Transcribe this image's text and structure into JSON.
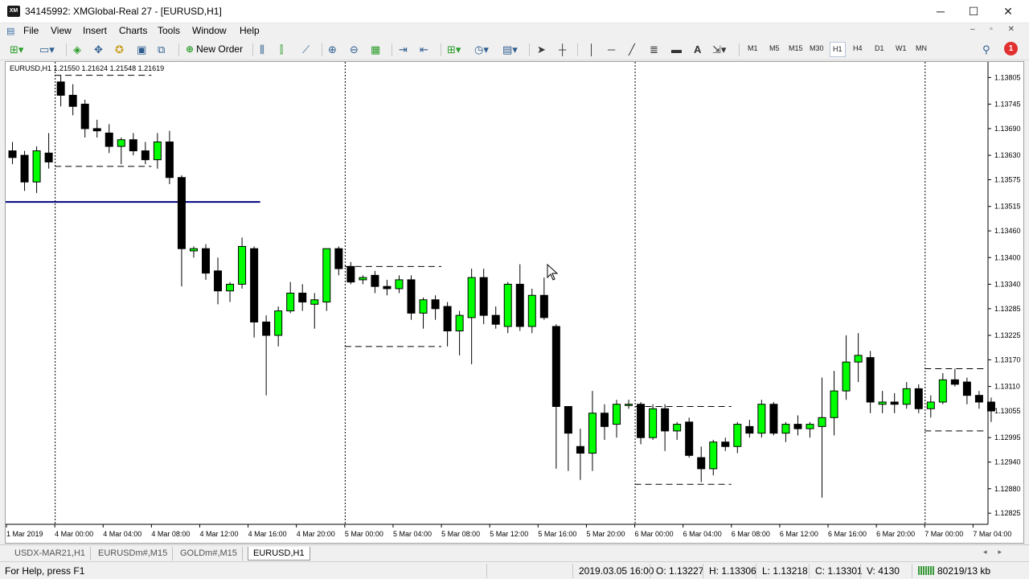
{
  "window": {
    "title": "34145992: XMGlobal-Real 27 - [EURUSD,H1]",
    "app_icon_text": "XM"
  },
  "menu": [
    "File",
    "View",
    "Insert",
    "Charts",
    "Tools",
    "Window",
    "Help"
  ],
  "toolbar": {
    "new_order_label": "New Order",
    "timeframes": [
      "M1",
      "M5",
      "M15",
      "M30",
      "H1",
      "H4",
      "D1",
      "W1",
      "MN"
    ],
    "active_timeframe": "H1",
    "alert_count": "1"
  },
  "chart": {
    "symbol_info": "EURUSD,H1  1.21550 1.21624 1.21548 1.21619",
    "colors": {
      "bull": "#00ff00",
      "bear": "#000000",
      "line": "#00007f",
      "grid": "#000000"
    }
  },
  "chart_data": {
    "type": "candlestick",
    "symbol": "EURUSD",
    "timeframe": "H1",
    "ylim": [
      1.128,
      1.1384
    ],
    "y_ticks": [
      "1.13805",
      "1.13745",
      "1.13690",
      "1.13630",
      "1.13575",
      "1.13515",
      "1.13460",
      "1.13400",
      "1.13340",
      "1.13285",
      "1.13225",
      "1.13170",
      "1.13110",
      "1.13055",
      "1.12995",
      "1.12940",
      "1.12880",
      "1.12825"
    ],
    "x_ticks": [
      "1 Mar 2019",
      "4 Mar 00:00",
      "4 Mar 04:00",
      "4 Mar 08:00",
      "4 Mar 12:00",
      "4 Mar 16:00",
      "4 Mar 20:00",
      "5 Mar 00:00",
      "5 Mar 04:00",
      "5 Mar 08:00",
      "5 Mar 12:00",
      "5 Mar 16:00",
      "5 Mar 20:00",
      "6 Mar 00:00",
      "6 Mar 04:00",
      "6 Mar 08:00",
      "6 Mar 12:00",
      "6 Mar 16:00",
      "6 Mar 20:00",
      "7 Mar 00:00",
      "7 Mar 04:00"
    ],
    "period_separators": [
      "4 Mar 00:00",
      "5 Mar 00:00",
      "6 Mar 00:00",
      "7 Mar 00:00"
    ],
    "horizontal_line": {
      "price": 1.13525,
      "from_bar": 0,
      "to_bar": 20
    },
    "range_boxes": [
      {
        "from_bar": 4,
        "to_bar": 12,
        "high": 1.1381,
        "low": 1.13605
      },
      {
        "from_bar": 28,
        "to_bar": 36,
        "high": 1.1338,
        "low": 1.132
      },
      {
        "from_bar": 52,
        "to_bar": 60,
        "high": 1.13065,
        "low": 1.1289
      },
      {
        "from_bar": 76,
        "to_bar": 81,
        "high": 1.1315,
        "low": 1.1301
      }
    ],
    "candles": [
      {
        "o": 1.1364,
        "h": 1.1366,
        "l": 1.1361,
        "c": 1.13625
      },
      {
        "o": 1.1363,
        "h": 1.1364,
        "l": 1.1355,
        "c": 1.1357
      },
      {
        "o": 1.1357,
        "h": 1.1365,
        "l": 1.13545,
        "c": 1.1364
      },
      {
        "o": 1.13635,
        "h": 1.1368,
        "l": 1.136,
        "c": 1.13615
      },
      {
        "o": 1.13795,
        "h": 1.1381,
        "l": 1.1374,
        "c": 1.13765
      },
      {
        "o": 1.13765,
        "h": 1.1379,
        "l": 1.1372,
        "c": 1.1374
      },
      {
        "o": 1.13745,
        "h": 1.13755,
        "l": 1.1367,
        "c": 1.1369
      },
      {
        "o": 1.1369,
        "h": 1.1371,
        "l": 1.1367,
        "c": 1.13685
      },
      {
        "o": 1.1368,
        "h": 1.137,
        "l": 1.13635,
        "c": 1.1365
      },
      {
        "o": 1.1365,
        "h": 1.1367,
        "l": 1.1361,
        "c": 1.13665
      },
      {
        "o": 1.13665,
        "h": 1.1368,
        "l": 1.1363,
        "c": 1.1364
      },
      {
        "o": 1.1364,
        "h": 1.1366,
        "l": 1.1361,
        "c": 1.1362
      },
      {
        "o": 1.1362,
        "h": 1.1368,
        "l": 1.136,
        "c": 1.1366
      },
      {
        "o": 1.1366,
        "h": 1.13685,
        "l": 1.13565,
        "c": 1.1358
      },
      {
        "o": 1.1358,
        "h": 1.13585,
        "l": 1.13335,
        "c": 1.1342
      },
      {
        "o": 1.13415,
        "h": 1.13425,
        "l": 1.134,
        "c": 1.1342
      },
      {
        "o": 1.1342,
        "h": 1.1343,
        "l": 1.1335,
        "c": 1.13365
      },
      {
        "o": 1.1337,
        "h": 1.134,
        "l": 1.13295,
        "c": 1.13325
      },
      {
        "o": 1.13325,
        "h": 1.13345,
        "l": 1.133,
        "c": 1.1334
      },
      {
        "o": 1.1334,
        "h": 1.13445,
        "l": 1.1333,
        "c": 1.13425
      },
      {
        "o": 1.1342,
        "h": 1.13425,
        "l": 1.1322,
        "c": 1.13255
      },
      {
        "o": 1.13255,
        "h": 1.1327,
        "l": 1.1309,
        "c": 1.13225
      },
      {
        "o": 1.13225,
        "h": 1.1329,
        "l": 1.132,
        "c": 1.1328
      },
      {
        "o": 1.1328,
        "h": 1.13345,
        "l": 1.13275,
        "c": 1.1332
      },
      {
        "o": 1.1332,
        "h": 1.1334,
        "l": 1.1328,
        "c": 1.133
      },
      {
        "o": 1.13295,
        "h": 1.1332,
        "l": 1.1324,
        "c": 1.13305
      },
      {
        "o": 1.133,
        "h": 1.1342,
        "l": 1.1328,
        "c": 1.1342
      },
      {
        "o": 1.1342,
        "h": 1.13425,
        "l": 1.1336,
        "c": 1.13375
      },
      {
        "o": 1.1338,
        "h": 1.1339,
        "l": 1.1334,
        "c": 1.13345
      },
      {
        "o": 1.1335,
        "h": 1.1336,
        "l": 1.1334,
        "c": 1.13355
      },
      {
        "o": 1.1336,
        "h": 1.1337,
        "l": 1.1332,
        "c": 1.13335
      },
      {
        "o": 1.13335,
        "h": 1.1335,
        "l": 1.13315,
        "c": 1.1333
      },
      {
        "o": 1.1333,
        "h": 1.1336,
        "l": 1.1332,
        "c": 1.1335
      },
      {
        "o": 1.1335,
        "h": 1.1336,
        "l": 1.1326,
        "c": 1.13275
      },
      {
        "o": 1.13275,
        "h": 1.1331,
        "l": 1.1324,
        "c": 1.13305
      },
      {
        "o": 1.13305,
        "h": 1.13315,
        "l": 1.1326,
        "c": 1.13285
      },
      {
        "o": 1.1329,
        "h": 1.133,
        "l": 1.132,
        "c": 1.13235
      },
      {
        "o": 1.13235,
        "h": 1.1328,
        "l": 1.1318,
        "c": 1.1327
      },
      {
        "o": 1.13265,
        "h": 1.13375,
        "l": 1.1316,
        "c": 1.13355
      },
      {
        "o": 1.13355,
        "h": 1.13375,
        "l": 1.1325,
        "c": 1.1327
      },
      {
        "o": 1.1327,
        "h": 1.1329,
        "l": 1.1324,
        "c": 1.1325
      },
      {
        "o": 1.13245,
        "h": 1.13345,
        "l": 1.1323,
        "c": 1.1334
      },
      {
        "o": 1.1334,
        "h": 1.13385,
        "l": 1.13235,
        "c": 1.13245
      },
      {
        "o": 1.13245,
        "h": 1.1333,
        "l": 1.1323,
        "c": 1.13315
      },
      {
        "o": 1.13315,
        "h": 1.13355,
        "l": 1.1326,
        "c": 1.13265
      },
      {
        "o": 1.13245,
        "h": 1.1325,
        "l": 1.12925,
        "c": 1.13065
      },
      {
        "o": 1.13065,
        "h": 1.13065,
        "l": 1.1292,
        "c": 1.13005
      },
      {
        "o": 1.12975,
        "h": 1.13015,
        "l": 1.129,
        "c": 1.1296
      },
      {
        "o": 1.1296,
        "h": 1.131,
        "l": 1.1292,
        "c": 1.1305
      },
      {
        "o": 1.1305,
        "h": 1.1307,
        "l": 1.1299,
        "c": 1.1302
      },
      {
        "o": 1.13025,
        "h": 1.1308,
        "l": 1.12995,
        "c": 1.1307
      },
      {
        "o": 1.1307,
        "h": 1.1308,
        "l": 1.1306,
        "c": 1.1307
      },
      {
        "o": 1.1307,
        "h": 1.13075,
        "l": 1.1298,
        "c": 1.12995
      },
      {
        "o": 1.12995,
        "h": 1.1307,
        "l": 1.1299,
        "c": 1.1306
      },
      {
        "o": 1.1306,
        "h": 1.1307,
        "l": 1.12965,
        "c": 1.1301
      },
      {
        "o": 1.1301,
        "h": 1.1303,
        "l": 1.1299,
        "c": 1.13025
      },
      {
        "o": 1.1303,
        "h": 1.1304,
        "l": 1.1295,
        "c": 1.12955
      },
      {
        "o": 1.1295,
        "h": 1.12975,
        "l": 1.12895,
        "c": 1.12925
      },
      {
        "o": 1.12925,
        "h": 1.1299,
        "l": 1.1291,
        "c": 1.12985
      },
      {
        "o": 1.12985,
        "h": 1.12995,
        "l": 1.12965,
        "c": 1.12975
      },
      {
        "o": 1.12975,
        "h": 1.1303,
        "l": 1.1296,
        "c": 1.13025
      },
      {
        "o": 1.1302,
        "h": 1.13035,
        "l": 1.12995,
        "c": 1.13005
      },
      {
        "o": 1.13005,
        "h": 1.1308,
        "l": 1.12995,
        "c": 1.1307
      },
      {
        "o": 1.1307,
        "h": 1.13075,
        "l": 1.13,
        "c": 1.13005
      },
      {
        "o": 1.13005,
        "h": 1.1303,
        "l": 1.12985,
        "c": 1.13025
      },
      {
        "o": 1.13025,
        "h": 1.13045,
        "l": 1.13,
        "c": 1.13015
      },
      {
        "o": 1.13015,
        "h": 1.1303,
        "l": 1.12995,
        "c": 1.13025
      },
      {
        "o": 1.1302,
        "h": 1.1313,
        "l": 1.1286,
        "c": 1.1304
      },
      {
        "o": 1.1304,
        "h": 1.13145,
        "l": 1.13,
        "c": 1.131
      },
      {
        "o": 1.131,
        "h": 1.13225,
        "l": 1.1308,
        "c": 1.13165
      },
      {
        "o": 1.13165,
        "h": 1.1323,
        "l": 1.1312,
        "c": 1.1318
      },
      {
        "o": 1.13175,
        "h": 1.1319,
        "l": 1.1305,
        "c": 1.13075
      },
      {
        "o": 1.1307,
        "h": 1.131,
        "l": 1.1305,
        "c": 1.13075
      },
      {
        "o": 1.13075,
        "h": 1.13095,
        "l": 1.1305,
        "c": 1.1307
      },
      {
        "o": 1.1307,
        "h": 1.1312,
        "l": 1.1306,
        "c": 1.13105
      },
      {
        "o": 1.13105,
        "h": 1.13115,
        "l": 1.1305,
        "c": 1.1306
      },
      {
        "o": 1.1306,
        "h": 1.1309,
        "l": 1.1304,
        "c": 1.13075
      },
      {
        "o": 1.13075,
        "h": 1.1314,
        "l": 1.1307,
        "c": 1.13125
      },
      {
        "o": 1.13125,
        "h": 1.1315,
        "l": 1.1311,
        "c": 1.13115
      },
      {
        "o": 1.1312,
        "h": 1.1313,
        "l": 1.1307,
        "c": 1.1309
      },
      {
        "o": 1.1309,
        "h": 1.131,
        "l": 1.1306,
        "c": 1.13075
      },
      {
        "o": 1.13075,
        "h": 1.13085,
        "l": 1.1303,
        "c": 1.13055
      }
    ]
  },
  "tabs": [
    "USDX-MAR21,H1",
    "EURUSDm#,M15",
    "GOLDm#,M15",
    "EURUSD,H1"
  ],
  "active_tab": "EURUSD,H1",
  "status": {
    "help": "For Help, press F1",
    "datetime": "2019.03.05 16:00",
    "open": "O: 1.13227",
    "high": "H: 1.13306",
    "low": "L: 1.13218",
    "close": "C: 1.13301",
    "volume": "V: 4130",
    "traffic": "80219/13 kb"
  }
}
